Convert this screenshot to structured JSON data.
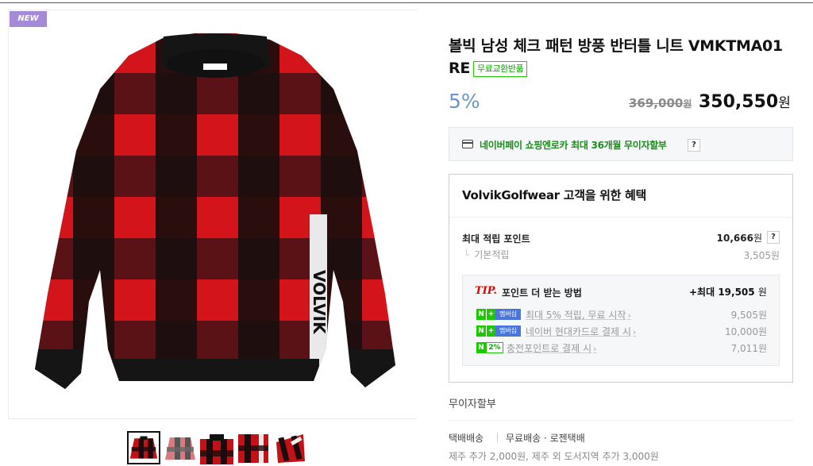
{
  "badge": {
    "label": "NEW"
  },
  "product": {
    "title": "볼빅 남성 체크 패턴 방풍 반터틀 니트 VMKTMA01 RE",
    "free_exchange_label": "무료교환반품"
  },
  "price": {
    "discount": "5%",
    "original": "369,000",
    "original_unit": "원",
    "final": "350,550",
    "final_unit": "원"
  },
  "npay": {
    "text": "네이버페이 쇼핑엔로카 최대 36개월 무이자할부",
    "help": "?"
  },
  "benefit": {
    "title": "VolvikGolfwear 고객을 위한 혜택",
    "max_points_label": "최대 적립 포인트",
    "max_points_value": "10,666",
    "max_points_unit": "원",
    "help": "?",
    "basic_label": "기본적립",
    "basic_value": "3,505원"
  },
  "tip": {
    "mark": "TIP.",
    "text": "포인트 더 받는 방법",
    "total_prefix": "+최대",
    "total_value": "19,505",
    "total_unit": "원",
    "rows": [
      {
        "badge_n": "N",
        "badge_plus": "+",
        "badge_mem": "멤버십",
        "link": "최대 5% 적립, 무료 시작",
        "chevron": "›",
        "amount": "9,505원"
      },
      {
        "badge_n": "N",
        "badge_plus": "+",
        "badge_mem": "멤버십",
        "link": "네이버 현대카드로 결제 시",
        "chevron": "›",
        "amount": "10,000원"
      },
      {
        "badge_n": "N",
        "badge_pct": "2%",
        "link": "충전포인트로 결제 시",
        "chevron": "›",
        "amount": "7,011원"
      }
    ]
  },
  "installment": {
    "label": "무이자할부"
  },
  "shipping": {
    "type": "택배배송",
    "method": "무료배송 · 로젠택배",
    "extra": "제주 추가 2,000원, 제주 외 도서지역 추가 3,000원"
  },
  "colors": {
    "plaid_red": "#d3151b",
    "plaid_black": "#151515",
    "naver_green": "#1ec800",
    "discount_blue": "#6a95cf",
    "tip_red": "#e50000"
  }
}
